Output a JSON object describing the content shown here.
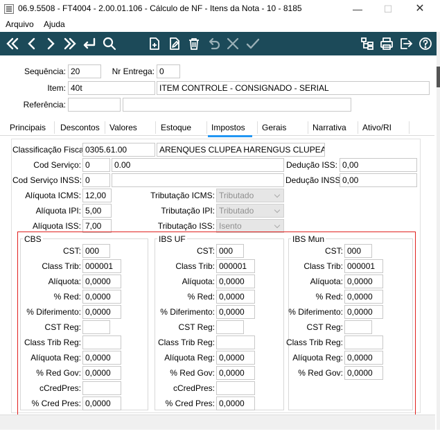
{
  "window": {
    "title": "06.9.5508 - FT4004 - 2.00.01.106 - Cálculo de NF - Itens da Nota - 10 - 8185",
    "min": "—",
    "max": "☐",
    "close": "✕"
  },
  "menu": {
    "items": [
      "Arquivo",
      "Ajuda"
    ]
  },
  "toolbar": {
    "icons": [
      "first-record-icon",
      "previous-record-icon",
      "next-record-icon",
      "last-record-icon",
      "return-icon",
      "search-icon",
      "new-document-icon",
      "edit-document-icon",
      "delete-icon",
      "undo-icon",
      "cancel-icon",
      "confirm-icon",
      "tree-structure-icon",
      "print-icon",
      "exit-icon",
      "help-icon"
    ]
  },
  "header": {
    "sequencia": {
      "label": "Sequência:",
      "value": "20"
    },
    "nr_entrega": {
      "label": "Nr Entrega:",
      "value": "0"
    },
    "item": {
      "label": "Item:",
      "code": "40t",
      "description": "ITEM CONTROLE - CONSIGNADO - SERIAL"
    },
    "referencia": {
      "label": "Referência:",
      "code": "",
      "description": ""
    }
  },
  "tabs": [
    "Principais",
    "Descontos",
    "Valores",
    "Estoque",
    "Impostos",
    "Gerais",
    "Narrativa",
    "Ativo/RI"
  ],
  "impostos": {
    "classificacao_fiscal": {
      "label": "Classificação Fiscal:",
      "code": "0305.61.00",
      "description": "ARENQUES CLUPEA HARENGUS CLUPEA PAL"
    },
    "cod_servico": {
      "label": "Cod Serviço:",
      "code": "0",
      "value": "0.00"
    },
    "cod_servico_inss": {
      "label": "Cod Serviço INSS:",
      "code": "0",
      "value": ""
    },
    "deducao_iss": {
      "label": "Dedução ISS:",
      "value": "0,00"
    },
    "deducao_inss": {
      "label": "Dedução INSS:",
      "value": "0,00"
    },
    "aliquota_icms": {
      "label": "Alíquota ICMS:",
      "value": "12,00"
    },
    "aliquota_ipi": {
      "label": "Alíquota IPI:",
      "value": "5,00"
    },
    "aliquota_iss": {
      "label": "Alíquota ISS:",
      "value": "7,00"
    },
    "tributacao_icms": {
      "label": "Tributação ICMS:",
      "value": "Tributado"
    },
    "tributacao_ipi": {
      "label": "Tributação IPI:",
      "value": "Tributado"
    },
    "tributacao_iss": {
      "label": "Tributação ISS:",
      "value": "Isento"
    }
  },
  "groups": [
    {
      "title": "CBS",
      "rows": [
        {
          "label": "CST:",
          "value": "000"
        },
        {
          "label": "Class Trib:",
          "value": "000001"
        },
        {
          "label": "Alíquota:",
          "value": "0,0000"
        },
        {
          "label": "% Red:",
          "value": "0,0000"
        },
        {
          "label": "% Diferimento:",
          "value": "0,0000"
        },
        {
          "label": "CST Reg:",
          "value": ""
        },
        {
          "label": "Class Trib Reg:",
          "value": ""
        },
        {
          "label": "Alíquota Reg:",
          "value": "0,0000"
        },
        {
          "label": "% Red Gov:",
          "value": "0,0000"
        },
        {
          "label": "cCredPres:",
          "value": ""
        },
        {
          "label": "% Cred Pres:",
          "value": "0,0000"
        }
      ]
    },
    {
      "title": "IBS UF",
      "rows": [
        {
          "label": "CST:",
          "value": "000"
        },
        {
          "label": "Class Trib:",
          "value": "000001"
        },
        {
          "label": "Alíquota:",
          "value": "0,0000"
        },
        {
          "label": "% Red:",
          "value": "0,0000"
        },
        {
          "label": "% Diferimento:",
          "value": "0,0000"
        },
        {
          "label": "CST Reg:",
          "value": ""
        },
        {
          "label": "Class Trib Reg:",
          "value": ""
        },
        {
          "label": "Alíquota Reg:",
          "value": "0,0000"
        },
        {
          "label": "% Red Gov:",
          "value": "0,0000"
        },
        {
          "label": "cCredPres:",
          "value": ""
        },
        {
          "label": "% Cred Pres:",
          "value": "0,0000"
        }
      ]
    },
    {
      "title": "IBS Mun",
      "rows": [
        {
          "label": "CST:",
          "value": "000"
        },
        {
          "label": "Class Trib:",
          "value": "000001"
        },
        {
          "label": "Alíquota:",
          "value": "0,0000"
        },
        {
          "label": "% Red:",
          "value": "0,0000"
        },
        {
          "label": "% Diferimento:",
          "value": "0,0000"
        },
        {
          "label": "CST Reg:",
          "value": ""
        },
        {
          "label": "Class Trib Reg:",
          "value": ""
        },
        {
          "label": "Alíquota Reg:",
          "value": "0,0000"
        },
        {
          "label": "% Red Gov:",
          "value": "0,0000"
        }
      ]
    }
  ],
  "colors": {
    "toolbar": "#1c4a59",
    "active_tab": "#2196f3",
    "highlight_border": "#e0201e"
  }
}
